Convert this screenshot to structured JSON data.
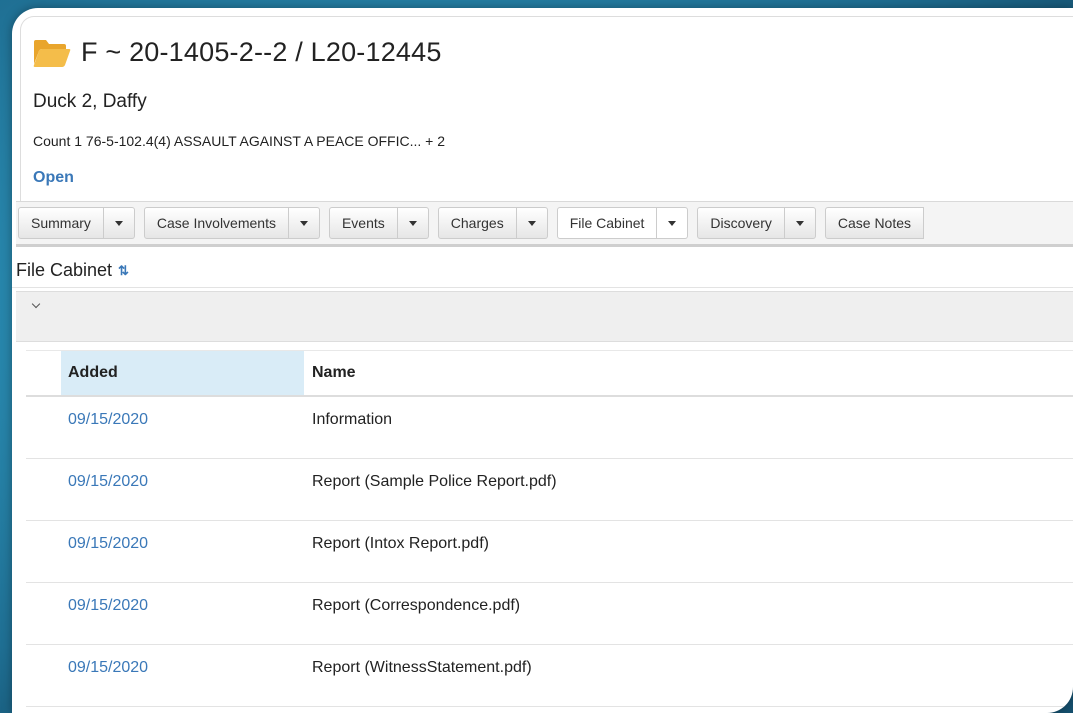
{
  "case": {
    "title": "F ~ 20-1405-2--2 / L20-12445",
    "party": "Duck 2, Daffy",
    "count_line": "Count 1 76-5-102.4(4) ASSAULT AGAINST A PEACE OFFIC... + 2",
    "status": "Open",
    "folder_icon": "folder-open-icon",
    "folder_color": "#f0b43c"
  },
  "tabs": [
    {
      "label": "Summary",
      "active": false
    },
    {
      "label": "Case Involvements",
      "active": false
    },
    {
      "label": "Events",
      "active": false
    },
    {
      "label": "Charges",
      "active": false
    },
    {
      "label": "File Cabinet",
      "active": true
    },
    {
      "label": "Discovery",
      "active": false
    },
    {
      "label": "Case Notes",
      "active": false
    }
  ],
  "file_cabinet": {
    "title": "File Cabinet",
    "refresh_icon": "refresh-icon",
    "collapse_icon": "chevron-down-icon",
    "columns": {
      "added": "Added",
      "name": "Name"
    },
    "rows": [
      {
        "added": "09/15/2020",
        "name": "Information"
      },
      {
        "added": "09/15/2020",
        "name": "Report (Sample Police Report.pdf)"
      },
      {
        "added": "09/15/2020",
        "name": "Report (Intox Report.pdf)"
      },
      {
        "added": "09/15/2020",
        "name": "Report (Correspondence.pdf)"
      },
      {
        "added": "09/15/2020",
        "name": "Report (WitnessStatement.pdf)"
      }
    ]
  },
  "colors": {
    "link": "#3a78b8",
    "header_highlight": "#d9ecf7",
    "background": "#2b8fb5"
  }
}
